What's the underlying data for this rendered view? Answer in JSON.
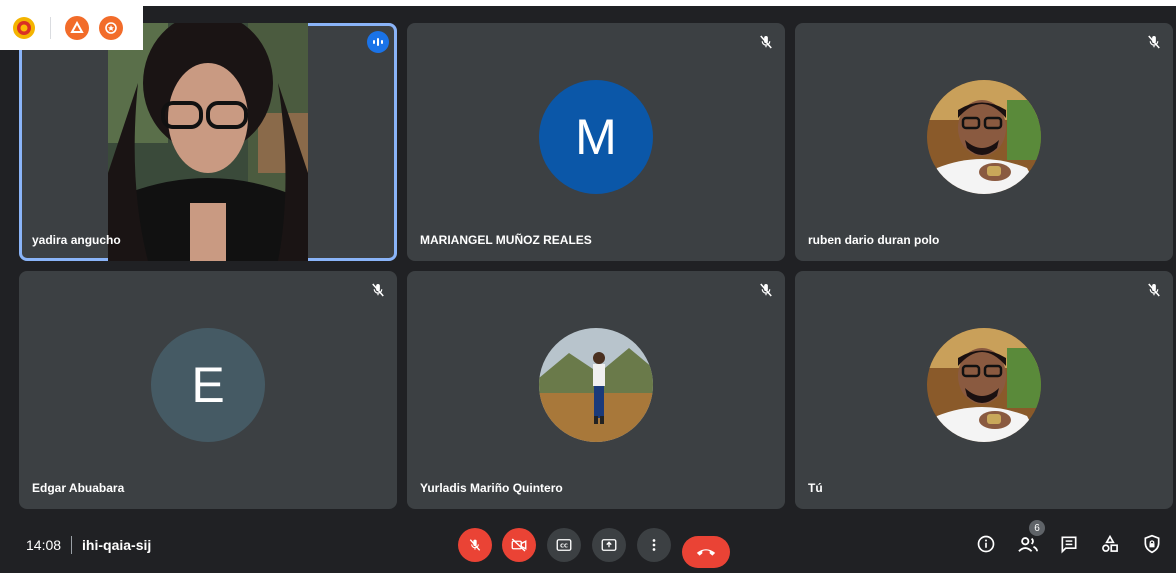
{
  "participants": [
    {
      "name": "yadira angucho",
      "speaking": true
    },
    {
      "name": "MARIANGEL MUÑOZ REALES",
      "initial": "M",
      "avatar_color": "#0b57a8"
    },
    {
      "name": "ruben dario duran polo"
    },
    {
      "name": "Edgar Abuabara",
      "initial": "E",
      "avatar_color": "#455a64"
    },
    {
      "name": "Yurladis Mariño Quintero"
    },
    {
      "name": "Tú"
    }
  ],
  "meeting": {
    "time": "14:08",
    "code": "ihi-qaia-sij",
    "participant_count": "6"
  },
  "colors": {
    "background": "#202124",
    "tile": "#3c4043",
    "accent_red": "#ea4335",
    "speaking_border": "#8ab4f8"
  },
  "controls": [
    "mic-off-icon",
    "camera-off-icon",
    "captions-icon",
    "present-screen-icon",
    "more-options-icon",
    "hangup-icon"
  ],
  "right_controls": [
    "info-icon",
    "people-icon",
    "chat-icon",
    "activities-icon",
    "host-controls-icon"
  ]
}
